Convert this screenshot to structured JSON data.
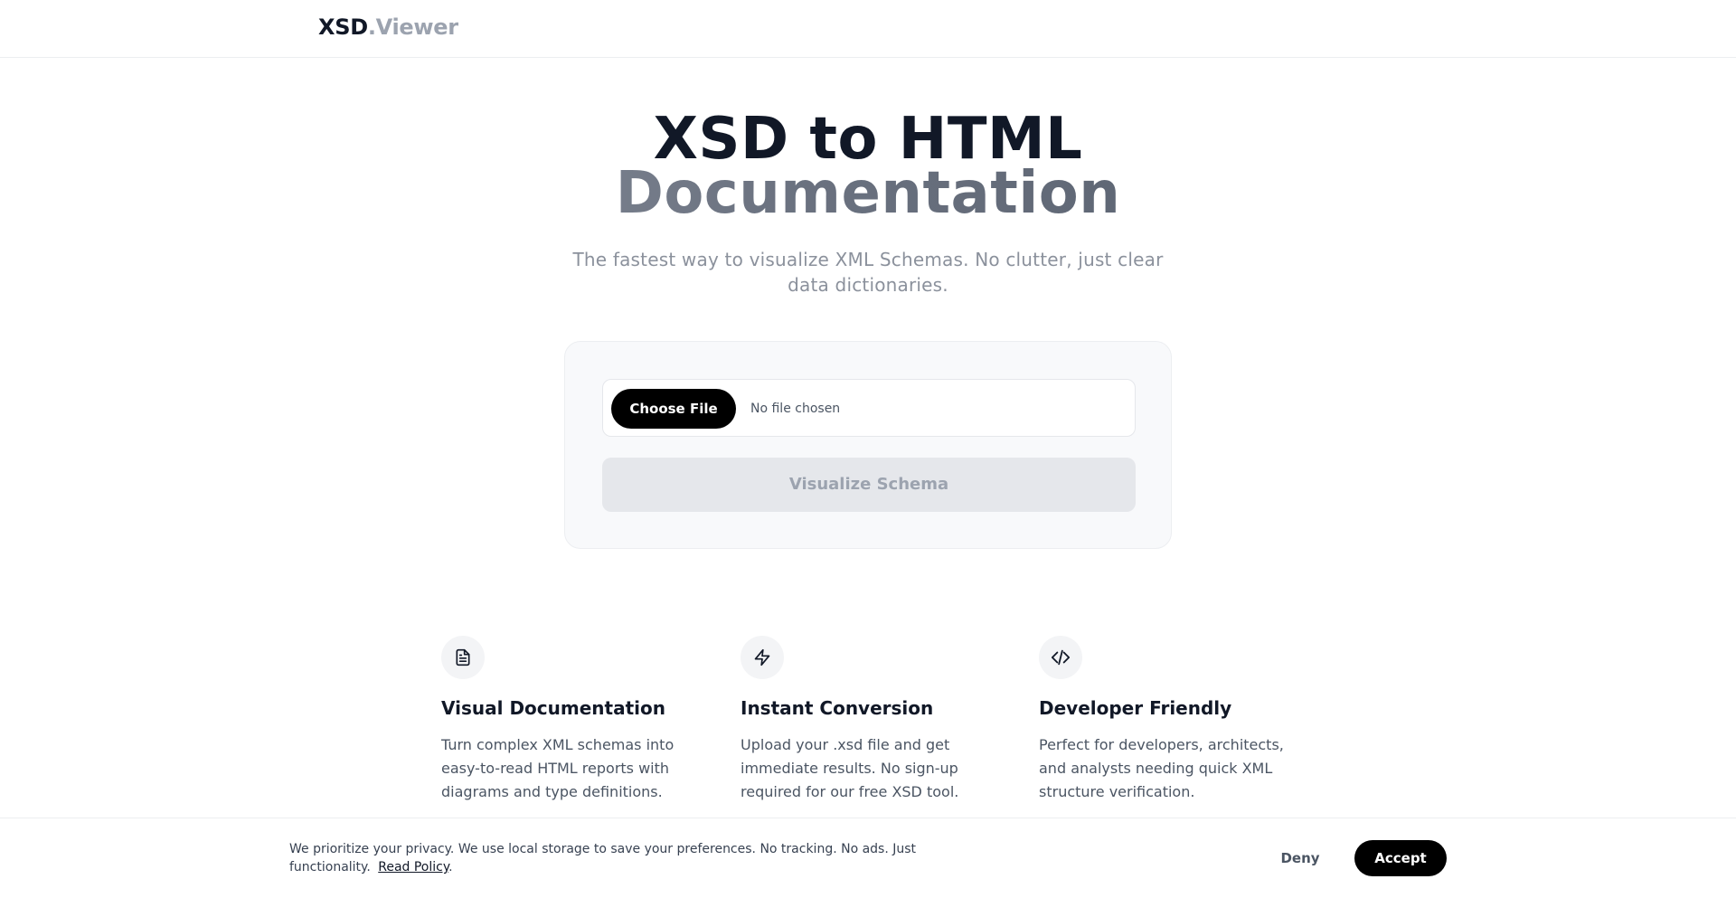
{
  "header": {
    "logo_part1": "XSD",
    "logo_part2": ".Viewer"
  },
  "hero": {
    "title_line1": "XSD to HTML",
    "title_line2": "Documentation",
    "subtitle": "The fastest way to visualize XML Schemas. No clutter, just clear data dictionaries."
  },
  "upload": {
    "choose_label": "Choose File",
    "file_status": "No file chosen",
    "submit_label": "Visualize Schema"
  },
  "features": [
    {
      "icon": "file-text-icon",
      "title": "Visual Documentation",
      "description": "Turn complex XML schemas into easy-to-read HTML reports with diagrams and type definitions."
    },
    {
      "icon": "lightning-icon",
      "title": "Instant Conversion",
      "description": "Upload your .xsd file and get immediate results. No sign-up required for our free XSD tool."
    },
    {
      "icon": "code-icon",
      "title": "Developer Friendly",
      "description": "Perfect for developers, architects, and analysts needing quick XML structure verification."
    }
  ],
  "cookie": {
    "message": "We prioritize your privacy. We use local storage to save your preferences. No tracking. No ads. Just functionality.",
    "link_label": "Read Policy",
    "link_suffix": ".",
    "deny_label": "Deny",
    "accept_label": "Accept"
  }
}
